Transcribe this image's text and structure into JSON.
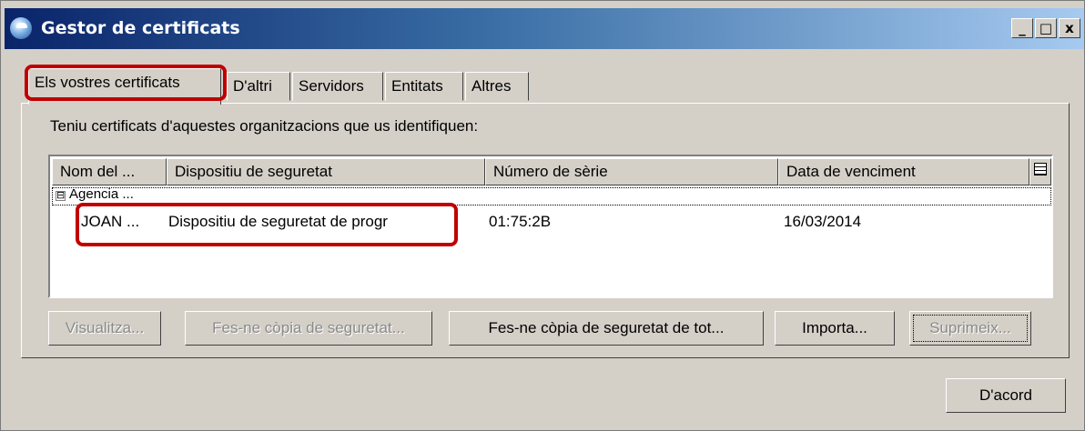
{
  "window": {
    "title": "Gestor de certificats",
    "controls": {
      "minimize": "_",
      "maximize": "□",
      "close": "x"
    }
  },
  "tabs": [
    {
      "label": "Els vostres certificats",
      "active": true
    },
    {
      "label": "D'altri"
    },
    {
      "label": "Servidors"
    },
    {
      "label": "Entitats"
    },
    {
      "label": "Altres"
    }
  ],
  "panel": {
    "prompt": "Teniu certificats d'aquestes organitzacions que us identifiquen:"
  },
  "table": {
    "columns": [
      "Nom del ...",
      "Dispositiu de seguretat",
      "Número de sèrie",
      "Data de venciment"
    ],
    "group": {
      "expander": "⊟",
      "label": "Agencia ..."
    },
    "rows": [
      {
        "name": "JOAN ...",
        "device": "Dispositiu de seguretat de progr",
        "serial": "01:75:2B",
        "expiry": "16/03/2014"
      }
    ]
  },
  "buttons": {
    "view": "Visualitza...",
    "backup": "Fes-ne còpia de seguretat...",
    "backup_all": "Fes-ne còpia de seguretat de tot...",
    "import": "Importa...",
    "delete": "Suprimeix..."
  },
  "footer": {
    "ok": "D'acord"
  },
  "colors": {
    "highlight": "#c00000",
    "titlebar_start": "#0a246a",
    "titlebar_end": "#a6caf0"
  }
}
